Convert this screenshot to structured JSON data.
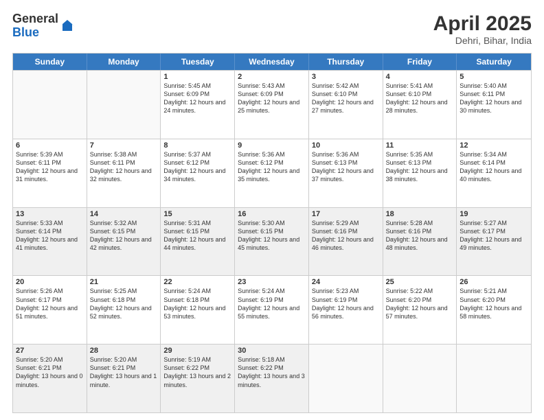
{
  "logo": {
    "general": "General",
    "blue": "Blue"
  },
  "header": {
    "month": "April 2025",
    "location": "Dehri, Bihar, India"
  },
  "weekdays": [
    "Sunday",
    "Monday",
    "Tuesday",
    "Wednesday",
    "Thursday",
    "Friday",
    "Saturday"
  ],
  "weeks": [
    [
      {
        "day": "",
        "sunrise": "",
        "sunset": "",
        "daylight": "",
        "shaded": true
      },
      {
        "day": "",
        "sunrise": "",
        "sunset": "",
        "daylight": "",
        "shaded": true
      },
      {
        "day": "1",
        "sunrise": "Sunrise: 5:45 AM",
        "sunset": "Sunset: 6:09 PM",
        "daylight": "Daylight: 12 hours and 24 minutes."
      },
      {
        "day": "2",
        "sunrise": "Sunrise: 5:43 AM",
        "sunset": "Sunset: 6:09 PM",
        "daylight": "Daylight: 12 hours and 25 minutes."
      },
      {
        "day": "3",
        "sunrise": "Sunrise: 5:42 AM",
        "sunset": "Sunset: 6:10 PM",
        "daylight": "Daylight: 12 hours and 27 minutes."
      },
      {
        "day": "4",
        "sunrise": "Sunrise: 5:41 AM",
        "sunset": "Sunset: 6:10 PM",
        "daylight": "Daylight: 12 hours and 28 minutes."
      },
      {
        "day": "5",
        "sunrise": "Sunrise: 5:40 AM",
        "sunset": "Sunset: 6:11 PM",
        "daylight": "Daylight: 12 hours and 30 minutes."
      }
    ],
    [
      {
        "day": "6",
        "sunrise": "Sunrise: 5:39 AM",
        "sunset": "Sunset: 6:11 PM",
        "daylight": "Daylight: 12 hours and 31 minutes."
      },
      {
        "day": "7",
        "sunrise": "Sunrise: 5:38 AM",
        "sunset": "Sunset: 6:11 PM",
        "daylight": "Daylight: 12 hours and 32 minutes."
      },
      {
        "day": "8",
        "sunrise": "Sunrise: 5:37 AM",
        "sunset": "Sunset: 6:12 PM",
        "daylight": "Daylight: 12 hours and 34 minutes."
      },
      {
        "day": "9",
        "sunrise": "Sunrise: 5:36 AM",
        "sunset": "Sunset: 6:12 PM",
        "daylight": "Daylight: 12 hours and 35 minutes."
      },
      {
        "day": "10",
        "sunrise": "Sunrise: 5:36 AM",
        "sunset": "Sunset: 6:13 PM",
        "daylight": "Daylight: 12 hours and 37 minutes."
      },
      {
        "day": "11",
        "sunrise": "Sunrise: 5:35 AM",
        "sunset": "Sunset: 6:13 PM",
        "daylight": "Daylight: 12 hours and 38 minutes."
      },
      {
        "day": "12",
        "sunrise": "Sunrise: 5:34 AM",
        "sunset": "Sunset: 6:14 PM",
        "daylight": "Daylight: 12 hours and 40 minutes."
      }
    ],
    [
      {
        "day": "13",
        "sunrise": "Sunrise: 5:33 AM",
        "sunset": "Sunset: 6:14 PM",
        "daylight": "Daylight: 12 hours and 41 minutes.",
        "shaded": true
      },
      {
        "day": "14",
        "sunrise": "Sunrise: 5:32 AM",
        "sunset": "Sunset: 6:15 PM",
        "daylight": "Daylight: 12 hours and 42 minutes.",
        "shaded": true
      },
      {
        "day": "15",
        "sunrise": "Sunrise: 5:31 AM",
        "sunset": "Sunset: 6:15 PM",
        "daylight": "Daylight: 12 hours and 44 minutes.",
        "shaded": true
      },
      {
        "day": "16",
        "sunrise": "Sunrise: 5:30 AM",
        "sunset": "Sunset: 6:15 PM",
        "daylight": "Daylight: 12 hours and 45 minutes.",
        "shaded": true
      },
      {
        "day": "17",
        "sunrise": "Sunrise: 5:29 AM",
        "sunset": "Sunset: 6:16 PM",
        "daylight": "Daylight: 12 hours and 46 minutes.",
        "shaded": true
      },
      {
        "day": "18",
        "sunrise": "Sunrise: 5:28 AM",
        "sunset": "Sunset: 6:16 PM",
        "daylight": "Daylight: 12 hours and 48 minutes.",
        "shaded": true
      },
      {
        "day": "19",
        "sunrise": "Sunrise: 5:27 AM",
        "sunset": "Sunset: 6:17 PM",
        "daylight": "Daylight: 12 hours and 49 minutes.",
        "shaded": true
      }
    ],
    [
      {
        "day": "20",
        "sunrise": "Sunrise: 5:26 AM",
        "sunset": "Sunset: 6:17 PM",
        "daylight": "Daylight: 12 hours and 51 minutes."
      },
      {
        "day": "21",
        "sunrise": "Sunrise: 5:25 AM",
        "sunset": "Sunset: 6:18 PM",
        "daylight": "Daylight: 12 hours and 52 minutes."
      },
      {
        "day": "22",
        "sunrise": "Sunrise: 5:24 AM",
        "sunset": "Sunset: 6:18 PM",
        "daylight": "Daylight: 12 hours and 53 minutes."
      },
      {
        "day": "23",
        "sunrise": "Sunrise: 5:24 AM",
        "sunset": "Sunset: 6:19 PM",
        "daylight": "Daylight: 12 hours and 55 minutes."
      },
      {
        "day": "24",
        "sunrise": "Sunrise: 5:23 AM",
        "sunset": "Sunset: 6:19 PM",
        "daylight": "Daylight: 12 hours and 56 minutes."
      },
      {
        "day": "25",
        "sunrise": "Sunrise: 5:22 AM",
        "sunset": "Sunset: 6:20 PM",
        "daylight": "Daylight: 12 hours and 57 minutes."
      },
      {
        "day": "26",
        "sunrise": "Sunrise: 5:21 AM",
        "sunset": "Sunset: 6:20 PM",
        "daylight": "Daylight: 12 hours and 58 minutes."
      }
    ],
    [
      {
        "day": "27",
        "sunrise": "Sunrise: 5:20 AM",
        "sunset": "Sunset: 6:21 PM",
        "daylight": "Daylight: 13 hours and 0 minutes.",
        "shaded": true
      },
      {
        "day": "28",
        "sunrise": "Sunrise: 5:20 AM",
        "sunset": "Sunset: 6:21 PM",
        "daylight": "Daylight: 13 hours and 1 minute.",
        "shaded": true
      },
      {
        "day": "29",
        "sunrise": "Sunrise: 5:19 AM",
        "sunset": "Sunset: 6:22 PM",
        "daylight": "Daylight: 13 hours and 2 minutes.",
        "shaded": true
      },
      {
        "day": "30",
        "sunrise": "Sunrise: 5:18 AM",
        "sunset": "Sunset: 6:22 PM",
        "daylight": "Daylight: 13 hours and 3 minutes.",
        "shaded": true
      },
      {
        "day": "",
        "sunrise": "",
        "sunset": "",
        "daylight": "",
        "empty": true
      },
      {
        "day": "",
        "sunrise": "",
        "sunset": "",
        "daylight": "",
        "empty": true
      },
      {
        "day": "",
        "sunrise": "",
        "sunset": "",
        "daylight": "",
        "empty": true
      }
    ]
  ]
}
